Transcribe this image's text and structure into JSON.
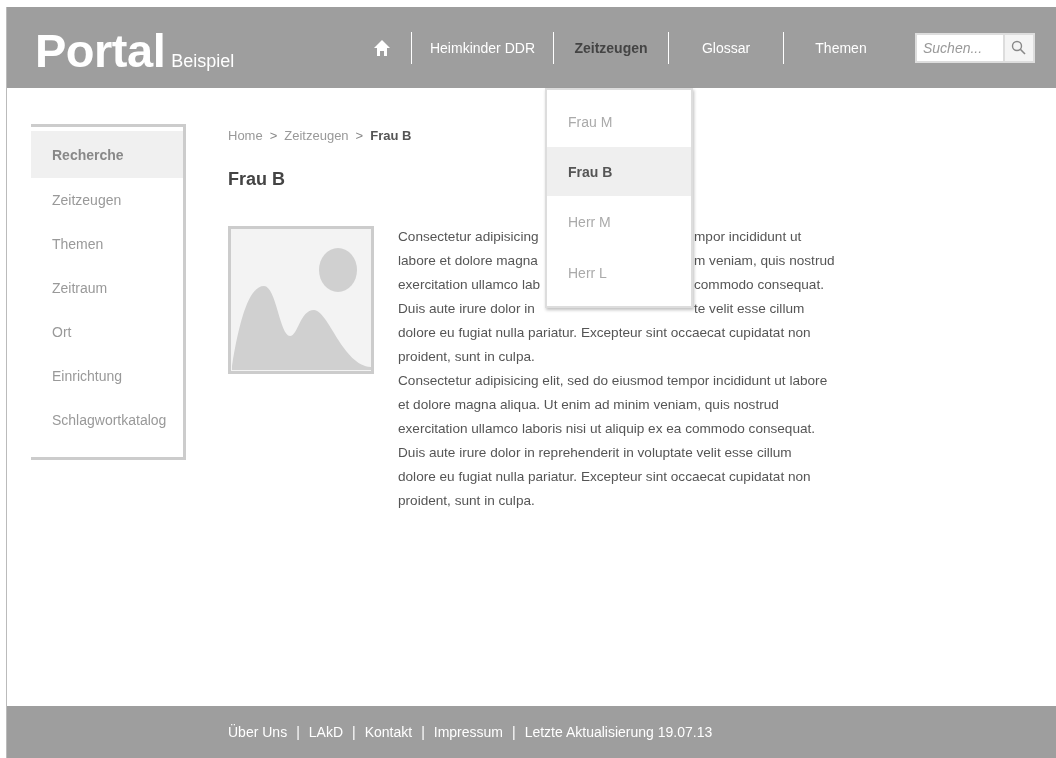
{
  "header": {
    "logo": "Portal",
    "logo_sub": "Beispiel",
    "nav": [
      {
        "label": "Heimkinder DDR",
        "selected": false
      },
      {
        "label": "Zeitzeugen",
        "selected": true
      },
      {
        "label": "Glossar",
        "selected": false
      },
      {
        "label": "Themen",
        "selected": false
      }
    ],
    "search": {
      "placeholder": "Suchen..."
    }
  },
  "dropdown": [
    {
      "label": "Frau M",
      "selected": false
    },
    {
      "label": "Frau B",
      "selected": true
    },
    {
      "label": "Herr M",
      "selected": false
    },
    {
      "label": "Herr L",
      "selected": false
    }
  ],
  "sidebar": [
    {
      "label": "Recherche",
      "selected": true
    },
    {
      "label": "Zeitzeugen",
      "selected": false
    },
    {
      "label": "Themen",
      "selected": false
    },
    {
      "label": "Zeitraum",
      "selected": false
    },
    {
      "label": "Ort",
      "selected": false
    },
    {
      "label": "Einrichtung",
      "selected": false
    },
    {
      "label": "Schlagwortkatalog",
      "selected": false
    }
  ],
  "breadcrumb": [
    {
      "label": "Home",
      "current": false
    },
    {
      "label": "Zeitzeugen",
      "current": false
    },
    {
      "label": "Frau B",
      "current": true
    }
  ],
  "breadcrumb_separator": ">",
  "title": "Frau B",
  "text_lines": [
    {
      "left": "Consectetur adipisicing",
      "right": "mpor incididunt ut"
    },
    {
      "left": "labore et dolore magna",
      "right": "m veniam, quis nostrud"
    },
    {
      "left": "exercitation ullamco lab",
      "right": "commodo consequat."
    },
    {
      "left": "Duis aute irure dolor in",
      "right": "te velit esse cillum"
    },
    {
      "left": "dolore eu fugiat nulla pariatur. Excepteur sint occaecat cupidatat non"
    },
    {
      "left": "proident, sunt in culpa."
    }
  ],
  "paragraph": "Consectetur adipisicing elit, sed do eiusmod tempor incididunt ut labore et dolore magna aliqua. Ut enim ad minim veniam, quis nostrud exercitation ullamco laboris nisi ut aliquip ex ea commodo consequat. Duis aute irure dolor in reprehenderit in voluptate velit esse cillum dolore eu fugiat nulla pariatur. Excepteur sint occaecat cupidatat non proident, sunt in culpa.",
  "footer": {
    "links": [
      "Über Uns",
      "LAkD",
      "Kontakt",
      "Impressum",
      "Letzte Aktualisierung 19.07.13"
    ],
    "separator": "|"
  }
}
